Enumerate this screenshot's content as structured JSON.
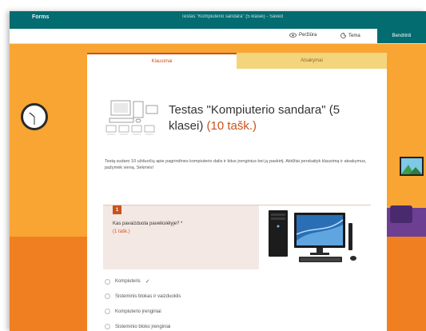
{
  "app": {
    "brand": "Forms",
    "document_title": "Testas \"Kompiuterio sandara\" (5 klasei) - Saved"
  },
  "toolbar": {
    "preview_label": "Peržiūra",
    "theme_label": "Tema",
    "share_label": "Bendrinti"
  },
  "tabs": [
    {
      "label": "Klausimai",
      "active": true
    },
    {
      "label": "Atsakymai",
      "active": false
    }
  ],
  "form": {
    "title": "Testas \"Kompiuterio sandara\" (5 klasei)",
    "points": "(10 tašk.)",
    "description": "Testą sudaro 10 užduočių apie pagrindines kompiuterio dalis ir kitus įrenginius bei jų paskirtį. Atidžiai perskaityk klausimą ir atsakymus, pažymėk vieną. Sėkmės!"
  },
  "question": {
    "number": "1",
    "text": "Kas pavaizduota paveikslėlyje? *",
    "points": "(1 tašk.)",
    "options": [
      {
        "label": "Kompiuteris",
        "correct": true
      },
      {
        "label": "Sisteminis blokas ir vaizduoklis",
        "correct": false
      },
      {
        "label": "Kompiuterio įrenginiai",
        "correct": false
      },
      {
        "label": "Sisteminio bloko įrenginiai",
        "correct": false
      }
    ]
  },
  "icons": {
    "preview": "eye-icon",
    "theme": "palette-icon",
    "correct": "checkmark-icon"
  },
  "colors": {
    "header": "#036c70",
    "accent": "#c9531b",
    "background": "#f9a533",
    "answers_tab": "#f3d57e"
  }
}
